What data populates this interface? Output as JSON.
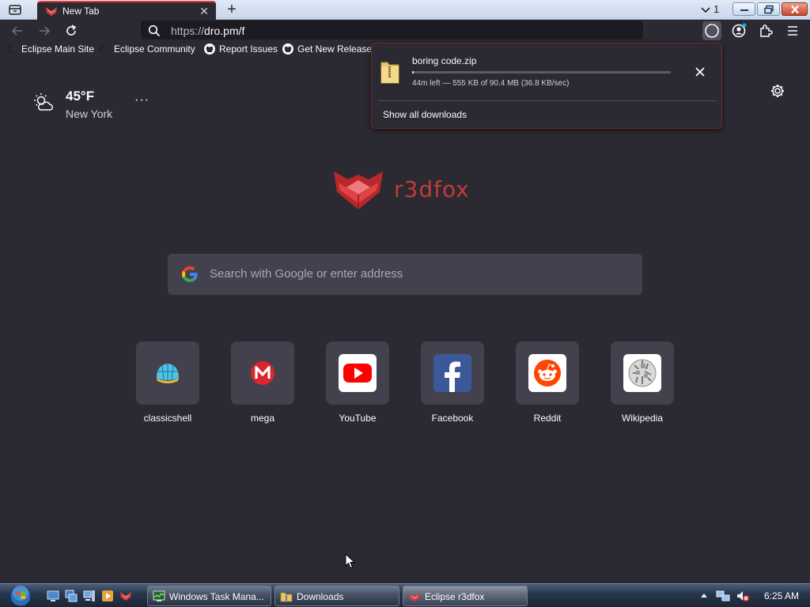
{
  "tab": {
    "title": "New Tab",
    "close": "✕"
  },
  "new_tab_button": "+",
  "tab_count": "1",
  "toolbar": {
    "url_prefix": "https://",
    "url_host": "dro.pm/f"
  },
  "bookmarks": [
    {
      "label": "Eclipse Main Site",
      "icon": "eclipse-icon"
    },
    {
      "label": "Eclipse Community",
      "icon": "eclipse-icon"
    },
    {
      "label": "Report Issues",
      "icon": "github-icon"
    },
    {
      "label": "Get New Releases",
      "icon": "github-icon"
    }
  ],
  "weather": {
    "temp": "45°F",
    "city": "New York",
    "more": "···"
  },
  "logo": {
    "text": "r3dfox"
  },
  "search": {
    "placeholder": "Search with Google or enter address"
  },
  "shortcuts": [
    {
      "label": "classicshell",
      "icon": "classicshell-icon"
    },
    {
      "label": "mega",
      "icon": "mega-icon"
    },
    {
      "label": "YouTube",
      "icon": "youtube-icon"
    },
    {
      "label": "Facebook",
      "icon": "facebook-icon"
    },
    {
      "label": "Reddit",
      "icon": "reddit-icon"
    },
    {
      "label": "Wikipedia",
      "icon": "wikipedia-icon"
    }
  ],
  "download": {
    "filename": "boring code.zip",
    "progress": 0.006,
    "status": "44m left — 555 KB of 90.4 MB (36.8 KB/sec)",
    "show_all": "Show all downloads"
  },
  "taskbar": {
    "items": [
      {
        "label": "Windows Task Mana...",
        "icon": "task-manager-icon"
      },
      {
        "label": "Downloads",
        "icon": "folder-icon"
      },
      {
        "label": "Eclipse r3dfox",
        "icon": "r3dfox-icon"
      }
    ],
    "clock": "6:25 AM"
  },
  "colors": {
    "accent": "#e23a3a",
    "background": "#2b2a33",
    "tile": "#42414d"
  }
}
